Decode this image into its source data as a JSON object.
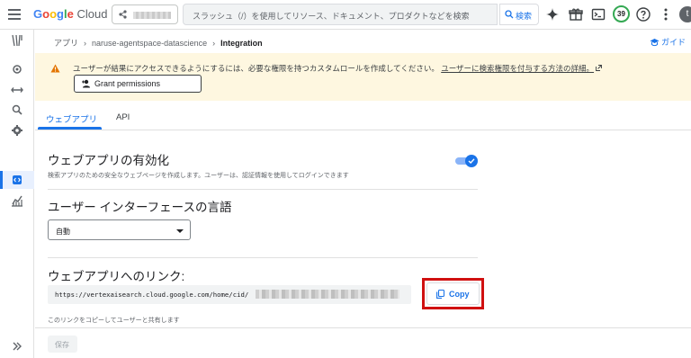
{
  "header": {
    "logo": {
      "g1": "G",
      "o1": "o",
      "o2": "o",
      "g2": "g",
      "l": "l",
      "e": "e",
      "cloud": " Cloud"
    },
    "search_placeholder": "スラッシュ（/）を使用してリソース、ドキュメント、プロダクトなどを検索",
    "search_button_label": "検索",
    "notifications_count": "39",
    "avatar_initial": "t"
  },
  "breadcrumb": {
    "items": [
      "アプリ",
      "naruse-agentspace-datascience"
    ],
    "current": "Integration",
    "separator": "›"
  },
  "guide_label": "ガイド",
  "banner": {
    "message": "ユーザーが結果にアクセスできるようにするには、必要な権限を持つカスタムロールを作成してください。",
    "link_text": "ユーザーに検索権限を付与する方法の詳細。",
    "grant_button_label": "Grant permissions"
  },
  "tabs": [
    "ウェブアプリ",
    "API"
  ],
  "webapp_section": {
    "title": "ウェブアプリの有効化",
    "description": "検索アプリのための安全なウェブページを作成します。ユーザーは、認証情報を使用してログインできます",
    "enabled": true
  },
  "language_section": {
    "title": "ユーザー インターフェースの言語",
    "selected": "自動"
  },
  "link_section": {
    "title": "ウェブアプリへのリンク:",
    "url": "https://vertexaisearch.cloud.google.com/home/cid/",
    "copy_label": "Copy",
    "note": "このリンクをコピーしてユーザーと共有します"
  },
  "save_label": "保存",
  "colors": {
    "accent": "#1a73e8",
    "banner_bg": "#fef7e0",
    "warning": "#e37400",
    "highlight": "#d01010"
  }
}
